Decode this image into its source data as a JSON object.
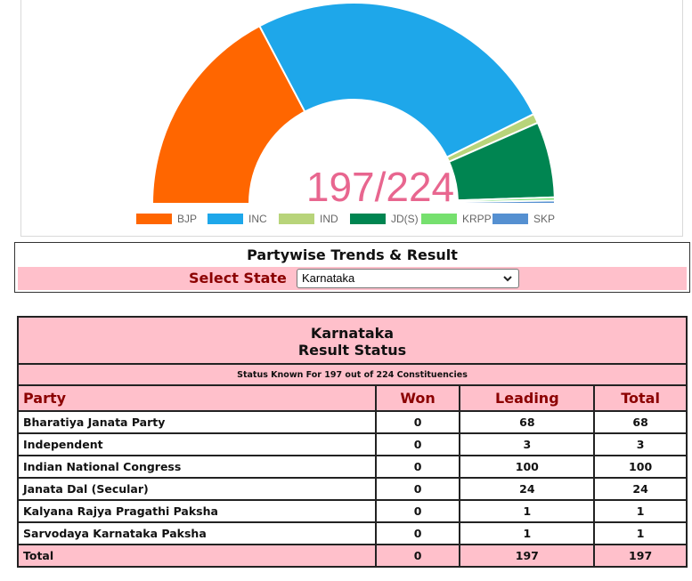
{
  "chart_data": {
    "type": "pie",
    "center_text": "197/224",
    "slices": [
      {
        "name": "BJP",
        "value": 68,
        "color": "#ff6600"
      },
      {
        "name": "INC",
        "value": 100,
        "color": "#1ea7ea"
      },
      {
        "name": "IND",
        "value": 3,
        "color": "#b8d47a"
      },
      {
        "name": "JD(S)",
        "value": 24,
        "color": "#008551"
      },
      {
        "name": "KRPP",
        "value": 1,
        "color": "#76e06e"
      },
      {
        "name": "SKP",
        "value": 1,
        "color": "#5590d1"
      }
    ],
    "legend_placement": "bottom"
  },
  "trends": {
    "title": "Partywise Trends & Result",
    "select_label": "Select State",
    "selected_state": "Karnataka"
  },
  "result": {
    "state": "Karnataka",
    "heading": "Result Status",
    "status_text": "Status Known For 197 out of 224 Constituencies",
    "columns": [
      "Party",
      "Won",
      "Leading",
      "Total"
    ],
    "rows": [
      {
        "party": "Bharatiya Janata Party",
        "won": "0",
        "leading": "68",
        "total": "68"
      },
      {
        "party": "Independent",
        "won": "0",
        "leading": "3",
        "total": "3"
      },
      {
        "party": "Indian National Congress",
        "won": "0",
        "leading": "100",
        "total": "100"
      },
      {
        "party": "Janata Dal (Secular)",
        "won": "0",
        "leading": "24",
        "total": "24"
      },
      {
        "party": "Kalyana Rajya Pragathi Paksha",
        "won": "0",
        "leading": "1",
        "total": "1"
      },
      {
        "party": "Sarvodaya Karnataka Paksha",
        "won": "0",
        "leading": "1",
        "total": "1"
      }
    ],
    "total": {
      "label": "Total",
      "won": "0",
      "leading": "197",
      "total": "197"
    }
  }
}
